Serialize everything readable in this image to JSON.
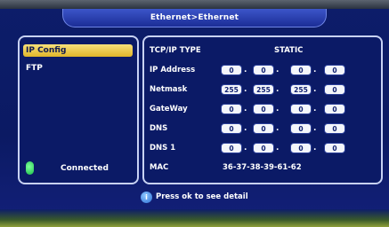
{
  "header": {
    "title": "Ethernet>Ethernet"
  },
  "sidebar": {
    "items": [
      {
        "label": "IP Config"
      },
      {
        "label": "FTP"
      }
    ],
    "status": "Connected"
  },
  "config": {
    "type_label": "TCP/IP TYPE",
    "type_value": "STATIC",
    "ip_label": "IP Address",
    "ip": [
      "0",
      "0",
      "0",
      "0"
    ],
    "netmask_label": "Netmask",
    "netmask": [
      "255",
      "255",
      "255",
      "0"
    ],
    "gateway_label": "GateWay",
    "gateway": [
      "0",
      "0",
      "0",
      "0"
    ],
    "dns_label": "DNS",
    "dns": [
      "0",
      "0",
      "0",
      "0"
    ],
    "dns1_label": "DNS 1",
    "dns1": [
      "0",
      "0",
      "0",
      "0"
    ],
    "mac_label": "MAC",
    "mac_value": "36-37-38-39-61-62"
  },
  "footer": {
    "hint": "Press ok to see detail",
    "hint_icon": "info-icon"
  },
  "colors": {
    "panel": "#0b1a66",
    "selected": "#e6c44a",
    "status": "#1bbf4a"
  }
}
